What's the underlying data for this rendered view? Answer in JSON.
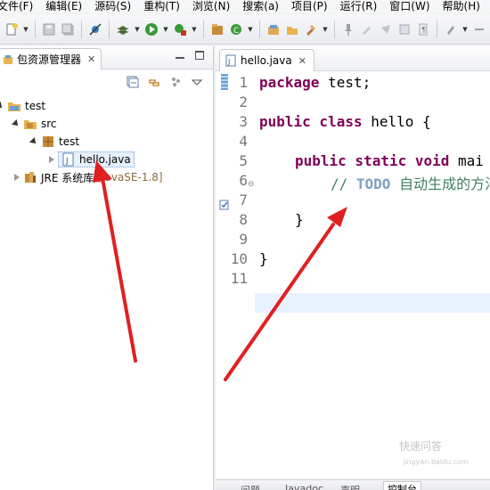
{
  "menubar": {
    "items": [
      "文件(F)",
      "编辑(E)",
      "源码(S)",
      "重构(T)",
      "浏览(N)",
      "搜索(a)",
      "项目(P)",
      "运行(R)",
      "窗口(W)",
      "帮助(H)"
    ]
  },
  "package_explorer": {
    "title": "包资源管理器",
    "close": "✕",
    "tree": {
      "project": "test",
      "src": "src",
      "package": "test",
      "file": "hello.java",
      "jre_label": "JRE 系统库",
      "jre_version": "[JavaSE-1.8]"
    }
  },
  "editor": {
    "tab_title": "hello.java",
    "tab_close": "✕",
    "line_numbers": [
      "1",
      "2",
      "3",
      "4",
      "5",
      "6",
      "7",
      "8",
      "9",
      "10",
      "11"
    ],
    "code": {
      "l1_kw": "package",
      "l1_rest": " test;",
      "l3_kw": "public class",
      "l3_rest": " hello {",
      "l5_kw": "public static void",
      "l5_rest": " mai",
      "l6_comment": "// ",
      "l6_todo": "TODO",
      "l6_text": " 自动生成的方法",
      "l8_brace": "}",
      "l10_brace": "}"
    }
  },
  "watermark": {
    "text": "快速问答",
    "sub": "jingyan.baidu.com"
  },
  "bottom_panel": {
    "tabs": [
      "问题",
      "Javadoc",
      "声明",
      "控制台"
    ]
  },
  "colors": {
    "keyword": "#7f0055",
    "comment": "#3f7f5f",
    "todo": "#7f9fbf",
    "annotation_arrow": "#e02020",
    "current_line": "#e8f2fe"
  }
}
